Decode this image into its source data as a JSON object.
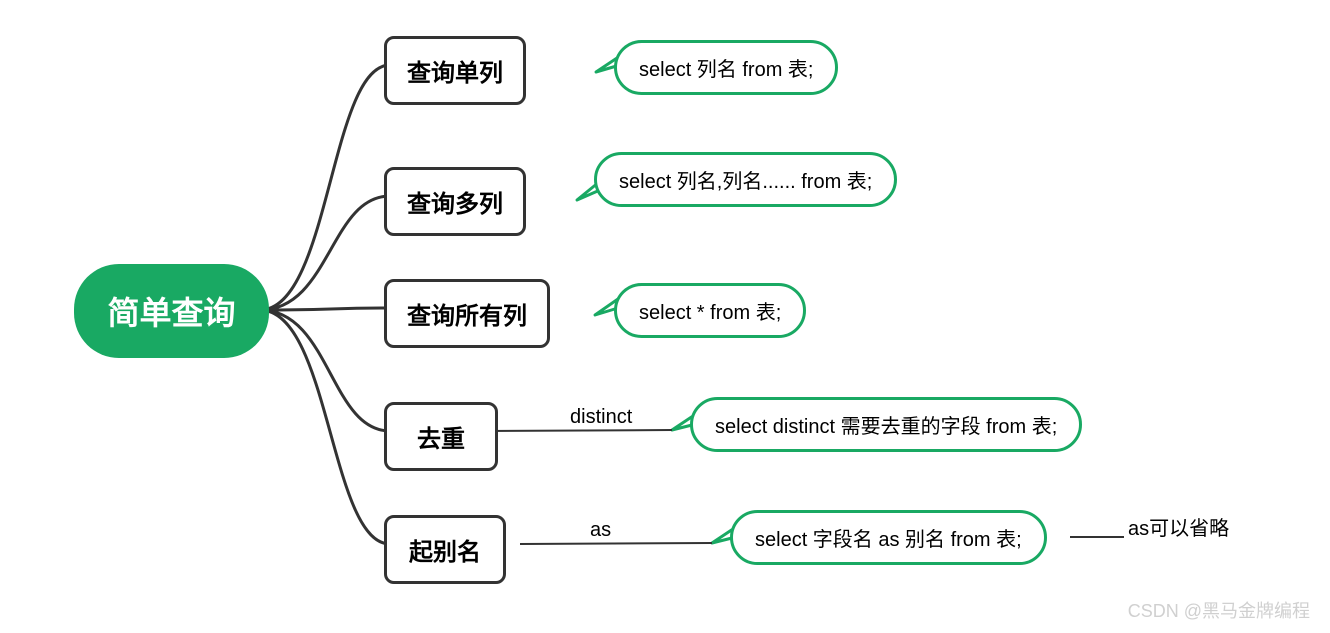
{
  "root": {
    "label": "简单查询"
  },
  "topics": [
    {
      "id": "t1",
      "label": "查询单列",
      "bubble": "select 列名 from 表;"
    },
    {
      "id": "t2",
      "label": "查询多列",
      "bubble": "select 列名,列名...... from 表;"
    },
    {
      "id": "t3",
      "label": "查询所有列",
      "bubble": "select * from 表;"
    },
    {
      "id": "t4",
      "label": "去重",
      "edge_label": "distinct",
      "bubble": "select distinct 需要去重的字段 from 表;"
    },
    {
      "id": "t5",
      "label": "起别名",
      "edge_label": "as",
      "bubble": "select 字段名 as 别名 from 表;",
      "trailing_label": "as可以省略"
    }
  ],
  "watermark": "CSDN @黑马金牌编程",
  "colors": {
    "accent": "#19a963",
    "stroke": "#333333"
  }
}
